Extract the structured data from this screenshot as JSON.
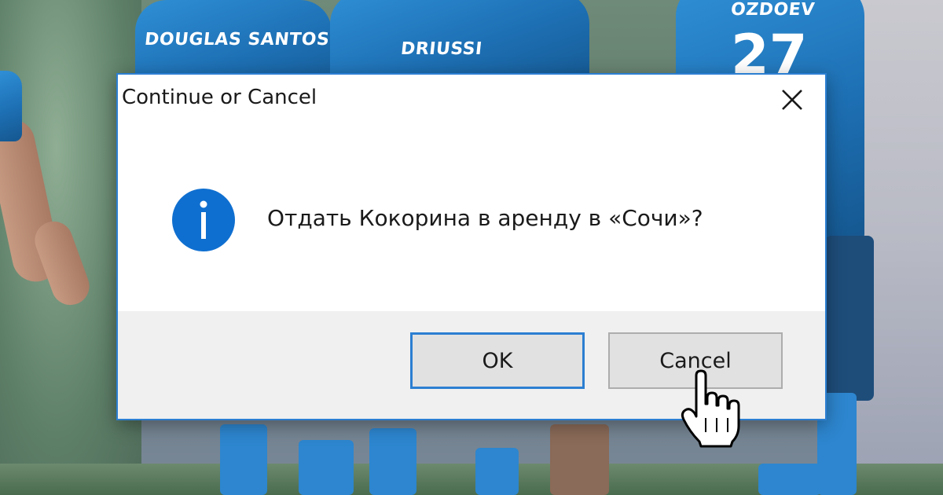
{
  "background": {
    "players": [
      {
        "name": "DOUGLAS SANTOS",
        "number": ""
      },
      {
        "name": "DRIUSSI",
        "number": ""
      },
      {
        "name": "OZDOEV",
        "number": "27"
      }
    ]
  },
  "dialog": {
    "title": "Continue or Cancel",
    "close_icon": "close-icon",
    "info_icon": "info-icon",
    "message": "Отдать Кокорина в аренду в «Сочи»?",
    "buttons": {
      "ok_label": "OK",
      "cancel_label": "Cancel"
    },
    "accent_color": "#2c7fd2",
    "icon_color": "#0f6fd0"
  },
  "cursor": "hand-pointer-icon"
}
